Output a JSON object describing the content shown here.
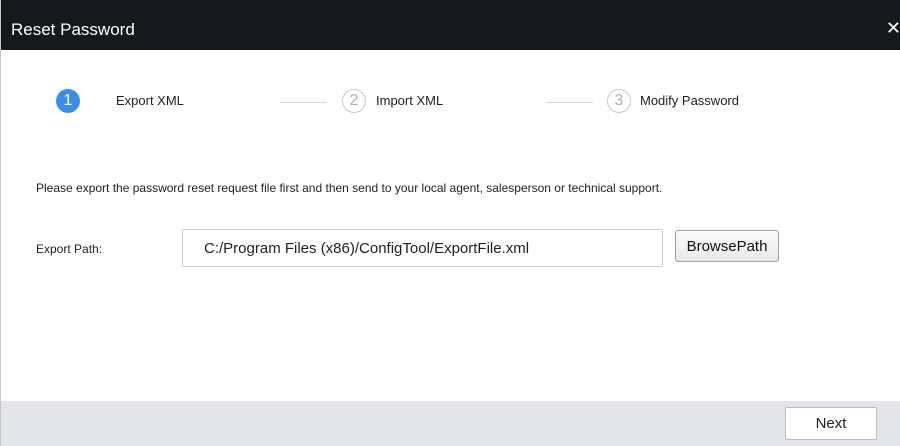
{
  "dialog": {
    "title": "Reset Password",
    "close_icon": "close-icon",
    "close_glyph": "✕"
  },
  "steps": [
    {
      "number": "1",
      "label": "Export XML",
      "state": "active"
    },
    {
      "number": "2",
      "label": "Import XML",
      "state": "inactive"
    },
    {
      "number": "3",
      "label": "Modify Password",
      "state": "inactive"
    }
  ],
  "instruction": "Please export the password reset request file first and then send to your local agent, salesperson or technical support.",
  "export_path": {
    "label": "Export Path:",
    "value": "C:/Program Files (x86)/ConfigTool/ExportFile.xml",
    "browse_label": "BrowsePath"
  },
  "footer": {
    "next_label": "Next"
  },
  "colors": {
    "titlebar": "#15191d",
    "active_step": "#3d8ee6",
    "footer": "#e3e5ea"
  }
}
